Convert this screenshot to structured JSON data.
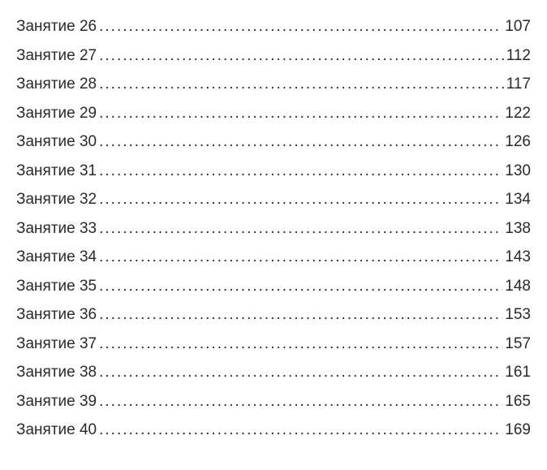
{
  "toc": {
    "label_prefix": "Занятие",
    "entries": [
      {
        "label": "Занятие 26",
        "page": "107"
      },
      {
        "label": "Занятие 27",
        "page": "112"
      },
      {
        "label": "Занятие 28",
        "page": "117"
      },
      {
        "label": "Занятие 29",
        "page": "122"
      },
      {
        "label": "Занятие 30",
        "page": "126"
      },
      {
        "label": "Занятие 31",
        "page": "130"
      },
      {
        "label": "Занятие 32",
        "page": "134"
      },
      {
        "label": "Занятие 33",
        "page": "138"
      },
      {
        "label": "Занятие 34",
        "page": "143"
      },
      {
        "label": "Занятие 35",
        "page": "148"
      },
      {
        "label": "Занятие 36",
        "page": "153"
      },
      {
        "label": "Занятие 37",
        "page": "157"
      },
      {
        "label": "Занятие 38",
        "page": "161"
      },
      {
        "label": "Занятие 39",
        "page": "165"
      },
      {
        "label": "Занятие 40",
        "page": "169"
      }
    ]
  }
}
